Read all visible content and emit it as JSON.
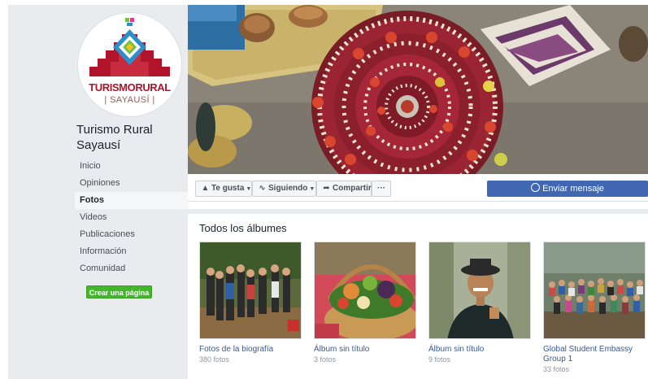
{
  "page": {
    "logo_word_1": "TURISMO",
    "logo_word_2": "RURAL",
    "logo_sub": "| SAYAUSÍ |",
    "name": "Turismo Rural Sayausí"
  },
  "nav": {
    "items": [
      {
        "label": "Inicio",
        "active": false
      },
      {
        "label": "Opiniones",
        "active": false
      },
      {
        "label": "Fotos",
        "active": true
      },
      {
        "label": "Videos",
        "active": false
      },
      {
        "label": "Publicaciones",
        "active": false
      },
      {
        "label": "Información",
        "active": false
      },
      {
        "label": "Comunidad",
        "active": false
      }
    ],
    "create_page": "Crear una página"
  },
  "actions": {
    "like": "Te gusta",
    "following": "Siguiendo",
    "share": "Compartir",
    "more": "···",
    "message": "Enviar mensaje"
  },
  "albums": {
    "title": "Todos los álbumes",
    "items": [
      {
        "name": "Fotos de la biografía",
        "count": "380 fotos"
      },
      {
        "name": "Álbum sin título",
        "count": "3 fotos"
      },
      {
        "name": "Álbum sin título",
        "count": "9 fotos"
      },
      {
        "name": "Global Student Embassy Group 1",
        "count": "33 fotos"
      }
    ]
  },
  "colors": {
    "facebook_blue": "#4267b2",
    "link_blue": "#365899",
    "create_green": "#42b72a",
    "sidebar_gray": "#e9ebee",
    "logo_red": "#b0142a"
  },
  "icons": {
    "like": "thumbs-up-icon",
    "following": "rss-icon",
    "share": "share-arrow-icon",
    "message": "messenger-icon"
  }
}
